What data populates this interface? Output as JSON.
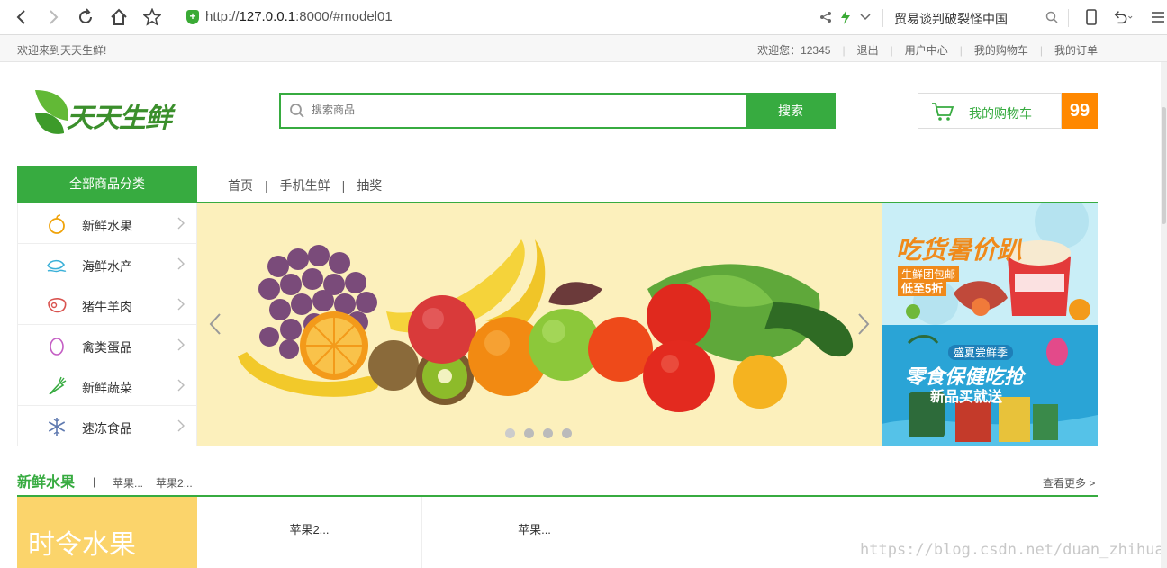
{
  "browser": {
    "url_prefix": "http://",
    "url_host": "127.0.0.1",
    "url_rest": ":8000/#model01",
    "search_text": "贸易谈判破裂怪中国"
  },
  "topbar": {
    "welcome": "欢迎来到天天生鲜!",
    "user_greeting": "欢迎您：12345",
    "links": [
      "退出",
      "用户中心",
      "我的购物车",
      "我的订单"
    ]
  },
  "header": {
    "logo_text": "天天生鲜",
    "search_placeholder": "搜索商品",
    "search_button": "搜索",
    "cart_label": "我的购物车",
    "cart_count": "99"
  },
  "nav": {
    "all_categories": "全部商品分类",
    "links": [
      "首页",
      "手机生鲜",
      "抽奖"
    ]
  },
  "categories": [
    {
      "label": "新鲜水果",
      "icon": "fruit-icon",
      "color": "#f0a30a"
    },
    {
      "label": "海鲜水产",
      "icon": "seafood-icon",
      "color": "#3ab0d8"
    },
    {
      "label": "猪牛羊肉",
      "icon": "meat-icon",
      "color": "#d9534f"
    },
    {
      "label": "禽类蛋品",
      "icon": "egg-icon",
      "color": "#c45ec4"
    },
    {
      "label": "新鲜蔬菜",
      "icon": "vegetable-icon",
      "color": "#37ab40"
    },
    {
      "label": "速冻食品",
      "icon": "snowflake-icon",
      "color": "#5f7ab0"
    }
  ],
  "banner": {
    "slide_count": 4,
    "active_slide": 1
  },
  "promos": [
    {
      "title": "吃货暑价趴",
      "sub": "生鲜团包邮",
      "sub2": "低至5折"
    },
    {
      "title": "零食保健吃抢",
      "sub": "盛夏尝鲜季",
      "sub2": "新品买就送"
    }
  ],
  "section": {
    "title": "新鲜水果",
    "links": [
      "苹果...",
      "苹果2..."
    ],
    "more": "查看更多 >",
    "season_label": "时令水果",
    "products": [
      "苹果2...",
      "苹果..."
    ]
  },
  "watermark": "https://blog.csdn.net/duan_zhihua",
  "colors": {
    "accent": "#37ab40",
    "cart_badge": "#ff8800",
    "season": "#fbd46b"
  }
}
